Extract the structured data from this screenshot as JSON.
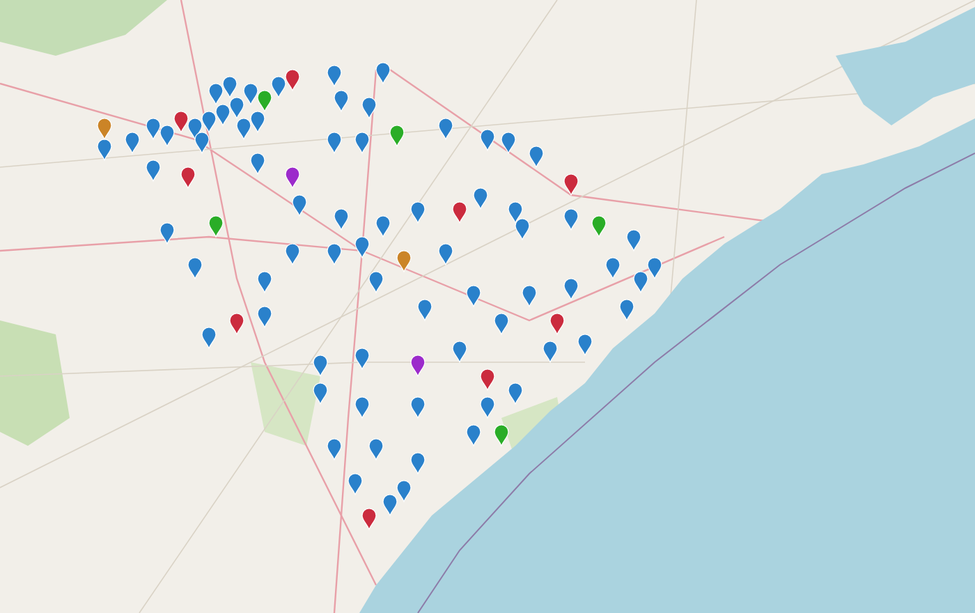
{
  "map": {
    "markers": [
      {
        "color": "#2a81cb"
      },
      {
        "color": "#2a81cb"
      },
      {
        "color": "#2a81cb"
      },
      {
        "color": "#2a81cb"
      },
      {
        "color": "#cb2b3e"
      },
      {
        "color": "#2a81cb"
      },
      {
        "color": "#2a81cb"
      },
      {
        "color": "#2a81cb"
      },
      {
        "color": "#2aad27"
      },
      {
        "color": "#2a81cb"
      },
      {
        "color": "#2a81cb"
      },
      {
        "color": "#2a81cb"
      },
      {
        "color": "#cb2b3e"
      },
      {
        "color": "#2a81cb"
      },
      {
        "color": "#2a81cb"
      },
      {
        "color": "#2a81cb"
      },
      {
        "color": "#2a81cb"
      },
      {
        "color": "#2a81cb"
      },
      {
        "color": "#cb8427"
      },
      {
        "color": "#2a81cb"
      },
      {
        "color": "#cb2b3e"
      },
      {
        "color": "#2a81cb"
      },
      {
        "color": "#9c2bcb"
      },
      {
        "color": "#2a81cb"
      },
      {
        "color": "#2a81cb"
      },
      {
        "color": "#2aad27"
      },
      {
        "color": "#2a81cb"
      },
      {
        "color": "#2a81cb"
      },
      {
        "color": "#2a81cb"
      },
      {
        "color": "#2a81cb"
      },
      {
        "color": "#cb2b3e"
      },
      {
        "color": "#2a81cb"
      },
      {
        "color": "#2a81cb"
      },
      {
        "color": "#2a81cb"
      },
      {
        "color": "#2a81cb"
      },
      {
        "color": "#2a81cb"
      },
      {
        "color": "#2a81cb"
      },
      {
        "color": "#2a81cb"
      },
      {
        "color": "#2a81cb"
      },
      {
        "color": "#2a81cb"
      },
      {
        "color": "#cb2b3e"
      },
      {
        "color": "#2a81cb"
      },
      {
        "color": "#2a81cb"
      },
      {
        "color": "#2a81cb"
      },
      {
        "color": "#2a81cb"
      },
      {
        "color": "#2aad27"
      },
      {
        "color": "#2a81cb"
      },
      {
        "color": "#2a81cb"
      },
      {
        "color": "#2a81cb"
      },
      {
        "color": "#2a81cb"
      },
      {
        "color": "#2a81cb"
      },
      {
        "color": "#2a81cb"
      },
      {
        "color": "#cb2b3e"
      },
      {
        "color": "#2a81cb"
      },
      {
        "color": "#2a81cb"
      },
      {
        "color": "#2a81cb"
      },
      {
        "color": "#2a81cb"
      },
      {
        "color": "#cb8427"
      },
      {
        "color": "#2a81cb"
      },
      {
        "color": "#2a81cb"
      },
      {
        "color": "#2a81cb"
      },
      {
        "color": "#2a81cb"
      },
      {
        "color": "#cb2b3e"
      },
      {
        "color": "#2a81cb"
      },
      {
        "color": "#2a81cb"
      },
      {
        "color": "#2a81cb"
      },
      {
        "color": "#2aad27"
      },
      {
        "color": "#2a81cb"
      },
      {
        "color": "#2a81cb"
      },
      {
        "color": "#2a81cb"
      },
      {
        "color": "#9c2bcb"
      },
      {
        "color": "#2a81cb"
      },
      {
        "color": "#cb2b3e"
      },
      {
        "color": "#2a81cb"
      },
      {
        "color": "#2a81cb"
      },
      {
        "color": "#2aad27"
      },
      {
        "color": "#2a81cb"
      },
      {
        "color": "#2a81cb"
      },
      {
        "color": "#2a81cb"
      },
      {
        "color": "#2a81cb"
      },
      {
        "color": "#2a81cb"
      },
      {
        "color": "#2a81cb"
      },
      {
        "color": "#cb2b3e"
      },
      {
        "color": "#2a81cb"
      },
      {
        "color": "#2a81cb"
      },
      {
        "color": "#2a81cb"
      },
      {
        "color": "#2a81cb"
      },
      {
        "color": "#2a81cb"
      },
      {
        "color": "#2a81cb"
      },
      {
        "color": "#2a81cb"
      }
    ]
  }
}
